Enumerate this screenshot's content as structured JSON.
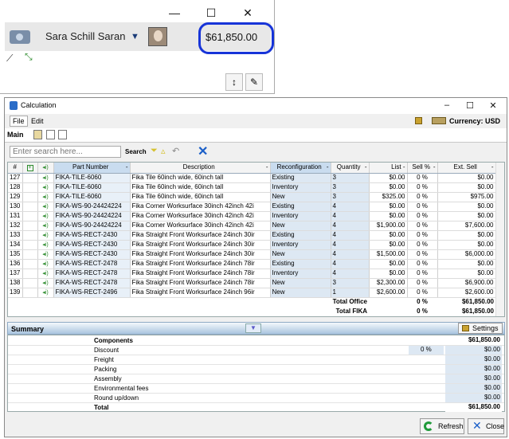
{
  "top": {
    "user_name": "Sara Schill Saran",
    "total_amount": "$61,850.00",
    "window_buttons": {
      "minimize": "—",
      "maximize": "☐",
      "close": "✕"
    }
  },
  "calc": {
    "title": "Calculation",
    "window_buttons": {
      "minimize": "–",
      "maximize": "☐",
      "close": "✕"
    },
    "menu": {
      "file": "File",
      "edit": "Edit"
    },
    "currency_label": "Currency: USD",
    "tab_main": "Main",
    "search": {
      "placeholder": "Enter search here...",
      "label": "Search"
    },
    "columns": [
      "#",
      "",
      "",
      "Part Number",
      "Description",
      "Reconfiguration",
      "Quantity",
      "List",
      "Sell %",
      "Ext. Sell"
    ],
    "rows": [
      {
        "num": "127",
        "part": "FIKA-TILE-6060",
        "desc": "Fika Tile 60inch wide, 60inch tall",
        "recon": "Existing",
        "qty": "3",
        "list": "$0.00",
        "sell": "0 %",
        "ext": "$0.00"
      },
      {
        "num": "128",
        "part": "FIKA-TILE-6060",
        "desc": "Fika Tile 60inch wide, 60inch tall",
        "recon": "Inventory",
        "qty": "3",
        "list": "$0.00",
        "sell": "0 %",
        "ext": "$0.00"
      },
      {
        "num": "129",
        "part": "FIKA-TILE-6060",
        "desc": "Fika Tile 60inch wide, 60inch tall",
        "recon": "New",
        "qty": "3",
        "list": "$325.00",
        "sell": "0 %",
        "ext": "$975.00"
      },
      {
        "num": "130",
        "part": "FIKA-WS-90-24424224",
        "desc": "Fika Corner Worksurface 30inch 42inch 42i",
        "recon": "Existing",
        "qty": "4",
        "list": "$0.00",
        "sell": "0 %",
        "ext": "$0.00"
      },
      {
        "num": "131",
        "part": "FIKA-WS-90-24424224",
        "desc": "Fika Corner Worksurface 30inch 42inch 42i",
        "recon": "Inventory",
        "qty": "4",
        "list": "$0.00",
        "sell": "0 %",
        "ext": "$0.00"
      },
      {
        "num": "132",
        "part": "FIKA-WS-90-24424224",
        "desc": "Fika Corner Worksurface 30inch 42inch 42i",
        "recon": "New",
        "qty": "4",
        "list": "$1,900.00",
        "sell": "0 %",
        "ext": "$7,600.00"
      },
      {
        "num": "133",
        "part": "FIKA-WS-RECT-2430",
        "desc": "Fika Straight Front Worksurface 24inch 30ir",
        "recon": "Existing",
        "qty": "4",
        "list": "$0.00",
        "sell": "0 %",
        "ext": "$0.00"
      },
      {
        "num": "134",
        "part": "FIKA-WS-RECT-2430",
        "desc": "Fika Straight Front Worksurface 24inch 30ir",
        "recon": "Inventory",
        "qty": "4",
        "list": "$0.00",
        "sell": "0 %",
        "ext": "$0.00"
      },
      {
        "num": "135",
        "part": "FIKA-WS-RECT-2430",
        "desc": "Fika Straight Front Worksurface 24inch 30ir",
        "recon": "New",
        "qty": "4",
        "list": "$1,500.00",
        "sell": "0 %",
        "ext": "$6,000.00"
      },
      {
        "num": "136",
        "part": "FIKA-WS-RECT-2478",
        "desc": "Fika Straight Front Worksurface 24inch 78ir",
        "recon": "Existing",
        "qty": "4",
        "list": "$0.00",
        "sell": "0 %",
        "ext": "$0.00"
      },
      {
        "num": "137",
        "part": "FIKA-WS-RECT-2478",
        "desc": "Fika Straight Front Worksurface 24inch 78ir",
        "recon": "Inventory",
        "qty": "4",
        "list": "$0.00",
        "sell": "0 %",
        "ext": "$0.00"
      },
      {
        "num": "138",
        "part": "FIKA-WS-RECT-2478",
        "desc": "Fika Straight Front Worksurface 24inch 78ir",
        "recon": "New",
        "qty": "3",
        "list": "$2,300.00",
        "sell": "0 %",
        "ext": "$6,900.00"
      },
      {
        "num": "139",
        "part": "FIKA-WS-RECT-2496",
        "desc": "Fika Straight Front Worksurface 24inch 96ir",
        "recon": "New",
        "qty": "1",
        "list": "$2,600.00",
        "sell": "0 %",
        "ext": "$2,600.00"
      }
    ],
    "totals": [
      {
        "label": "Total Office",
        "sell": "0 %",
        "ext": "$61,850.00"
      },
      {
        "label": "Total FIKA",
        "sell": "0 %",
        "ext": "$61,850.00"
      }
    ],
    "summary": {
      "title": "Summary",
      "settings_label": "Settings",
      "components_label": "Components",
      "components_value": "$61,850.00",
      "discount": {
        "label": "Discount",
        "pct": "0 %",
        "value": "$0.00"
      },
      "freight": {
        "label": "Freight",
        "value": "$0.00"
      },
      "packing": {
        "label": "Packing",
        "value": "$0.00"
      },
      "assembly": {
        "label": "Assembly",
        "value": "$0.00"
      },
      "env_fees": {
        "label": "Environmental fees",
        "value": "$0.00"
      },
      "round": {
        "label": "Round up/down",
        "value": "$0.00"
      },
      "total": {
        "label": "Total",
        "value": "$61,850.00"
      }
    },
    "footer": {
      "refresh": "Refresh",
      "close": "Close"
    }
  }
}
